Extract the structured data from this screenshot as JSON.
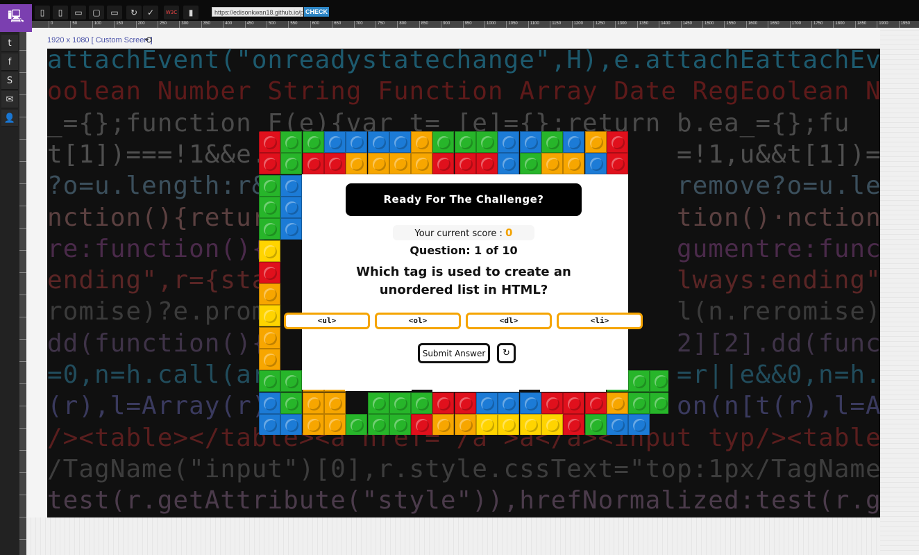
{
  "toolbar": {
    "icons": [
      "tablet-icon",
      "phone-icon",
      "desktop-icon",
      "tv-icon",
      "monitor-icon",
      "refresh-icon",
      "accessibility-icon",
      "w3c-icon",
      "stats-icon"
    ],
    "w3c_label": "W3C",
    "url": "https://edisonkwan18.github.io/project",
    "check_label": "CHECK"
  },
  "ruler": {
    "ticks": [
      "0",
      "50",
      "100",
      "150",
      "200",
      "250",
      "300",
      "350",
      "400",
      "450",
      "500",
      "550",
      "600",
      "650",
      "700",
      "750",
      "800",
      "850",
      "900",
      "950",
      "1000",
      "1050",
      "1100",
      "1150",
      "1200",
      "1250",
      "1300",
      "1350",
      "1400",
      "1450",
      "1500",
      "1550",
      "1600",
      "1650",
      "1700",
      "1750",
      "1800",
      "1850",
      "1900",
      "1950"
    ]
  },
  "sidebar": {
    "icons": [
      "tumblr-icon",
      "facebook-icon",
      "skype-icon",
      "mail-icon",
      "user-icon"
    ]
  },
  "screen": {
    "info": "1920 x 1080 [ Custom Screen ]"
  },
  "background_code": [
    {
      "text": "attachEvent(\"onreadystatechange\",H),e.attachEattachEv",
      "color": "#1d5a6e"
    },
    {
      "text": "oolean Number String Function Array Date RegEoolean N",
      "color": "#5e1a1a"
    },
    {
      "text": "_={};function F(e){var t= [e]={};return b.ea_={};fu",
      "color": "#4a4a4a"
    },
    {
      "text": "t[1])===!1&&e.                          =!1,u&&t[1])===",
      "color": "#4f4f4f"
    },
    {
      "text": "?o=u.length:r&                          remove?o=u.len",
      "color": "#3b4f5c"
    },
    {
      "text": "nction(){retur                          tion()·nction()",
      "color": "#5b4040"
    },
    {
      "text": "re:function(){                          gumentre:funct",
      "color": "#4a2a4a"
    },
    {
      "text": "ending\",r={sta                          lways:ending\",",
      "color": "#5a2525"
    },
    {
      "text": "romise)?e.prom                          l(n.reromise)?",
      "color": "#3b3b3b"
    },
    {
      "text": "dd(function(){                          2][2].dd(funct",
      "color": "#3f3348"
    },
    {
      "text": "=0,n=h.call(ar                          =r||e&&0,n=h.c",
      "color": "#214c5c"
    },
    {
      "text": "(r),l=Array(r)                          on(n[t(r),l=Ar",
      "color": "#3a3a5e"
    },
    {
      "text": "/><table></table><a href='/a'>a</a><input typ/><table",
      "color": "#5a1e1e"
    },
    {
      "text": "/TagName(\"input\")[0],r.style.cssText=\"top:1px/TagName",
      "color": "#3d3d3d"
    },
    {
      "text": "test(r.getAttribute(\"style\")),hrefNormalized:test(r.g",
      "color": "#4b3b4b"
    }
  ],
  "quiz": {
    "banner": "Ready For The Challenge?",
    "score_label": "Your current score : ",
    "score_value": "0",
    "question_number": "Question:  1 of 10",
    "question_text": "Which tag is used to create an unordered list in HTML?",
    "options": [
      "<ul>",
      "<ol>",
      "<dl>",
      "<li>"
    ],
    "submit_label": "Submit Answer",
    "refresh_symbol": "↻",
    "accent_color": "#f5a400"
  },
  "colors": {
    "red": "#e0101c",
    "green": "#27b52a",
    "blue": "#1c7bd6",
    "orange": "#f7a600",
    "yellow": "#ffd400"
  }
}
